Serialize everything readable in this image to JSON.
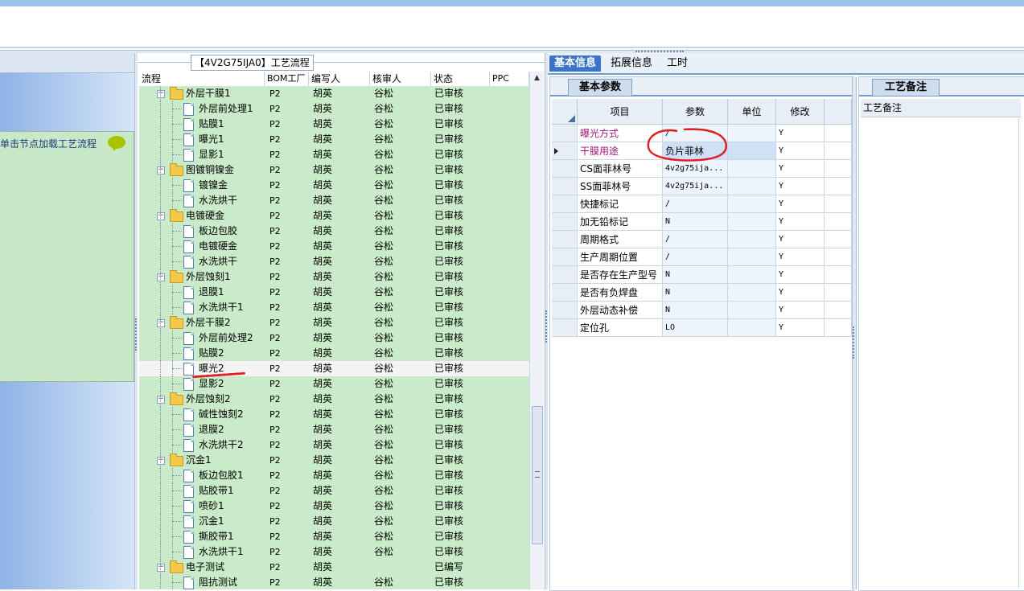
{
  "process_panel": {
    "title": "【4V2G75IJA0】工艺流程",
    "columns": [
      "流程",
      "BOM工厂",
      "编写人",
      "核审人",
      "状态",
      "PPC"
    ]
  },
  "left_panel": {
    "hint": "单击节点加载工艺流程"
  },
  "tree_rows": [
    {
      "level": 0,
      "name": "外层干膜1",
      "bom": "P2",
      "writer": "胡英",
      "reviewer": "谷松",
      "status": "已审核"
    },
    {
      "level": 1,
      "name": "外层前处理1",
      "bom": "P2",
      "writer": "胡英",
      "reviewer": "谷松",
      "status": "已审核"
    },
    {
      "level": 1,
      "name": "贴膜1",
      "bom": "P2",
      "writer": "胡英",
      "reviewer": "谷松",
      "status": "已审核"
    },
    {
      "level": 1,
      "name": "曝光1",
      "bom": "P2",
      "writer": "胡英",
      "reviewer": "谷松",
      "status": "已审核"
    },
    {
      "level": 1,
      "name": "显影1",
      "bom": "P2",
      "writer": "胡英",
      "reviewer": "谷松",
      "status": "已审核"
    },
    {
      "level": 0,
      "name": "图镀铜镍金",
      "bom": "P2",
      "writer": "胡英",
      "reviewer": "谷松",
      "status": "已审核"
    },
    {
      "level": 1,
      "name": "镀镍金",
      "bom": "P2",
      "writer": "胡英",
      "reviewer": "谷松",
      "status": "已审核"
    },
    {
      "level": 1,
      "name": "水洗烘干",
      "bom": "P2",
      "writer": "胡英",
      "reviewer": "谷松",
      "status": "已审核"
    },
    {
      "level": 0,
      "name": "电镀硬金",
      "bom": "P2",
      "writer": "胡英",
      "reviewer": "谷松",
      "status": "已审核"
    },
    {
      "level": 1,
      "name": "板边包胶",
      "bom": "P2",
      "writer": "胡英",
      "reviewer": "谷松",
      "status": "已审核"
    },
    {
      "level": 1,
      "name": "电镀硬金",
      "bom": "P2",
      "writer": "胡英",
      "reviewer": "谷松",
      "status": "已审核"
    },
    {
      "level": 1,
      "name": "水洗烘干",
      "bom": "P2",
      "writer": "胡英",
      "reviewer": "谷松",
      "status": "已审核"
    },
    {
      "level": 0,
      "name": "外层蚀刻1",
      "bom": "P2",
      "writer": "胡英",
      "reviewer": "谷松",
      "status": "已审核"
    },
    {
      "level": 1,
      "name": "退膜1",
      "bom": "P2",
      "writer": "胡英",
      "reviewer": "谷松",
      "status": "已审核"
    },
    {
      "level": 1,
      "name": "水洗烘干1",
      "bom": "P2",
      "writer": "胡英",
      "reviewer": "谷松",
      "status": "已审核"
    },
    {
      "level": 0,
      "name": "外层干膜2",
      "bom": "P2",
      "writer": "胡英",
      "reviewer": "谷松",
      "status": "已审核"
    },
    {
      "level": 1,
      "name": "外层前处理2",
      "bom": "P2",
      "writer": "胡英",
      "reviewer": "谷松",
      "status": "已审核"
    },
    {
      "level": 1,
      "name": "贴膜2",
      "bom": "P2",
      "writer": "胡英",
      "reviewer": "谷松",
      "status": "已审核"
    },
    {
      "level": 1,
      "name": "曝光2",
      "bom": "P2",
      "writer": "胡英",
      "reviewer": "谷松",
      "status": "已审核",
      "selected": true
    },
    {
      "level": 1,
      "name": "显影2",
      "bom": "P2",
      "writer": "胡英",
      "reviewer": "谷松",
      "status": "已审核"
    },
    {
      "level": 0,
      "name": "外层蚀刻2",
      "bom": "P2",
      "writer": "胡英",
      "reviewer": "谷松",
      "status": "已审核"
    },
    {
      "level": 1,
      "name": "碱性蚀刻2",
      "bom": "P2",
      "writer": "胡英",
      "reviewer": "谷松",
      "status": "已审核"
    },
    {
      "level": 1,
      "name": "退膜2",
      "bom": "P2",
      "writer": "胡英",
      "reviewer": "谷松",
      "status": "已审核"
    },
    {
      "level": 1,
      "name": "水洗烘干2",
      "bom": "P2",
      "writer": "胡英",
      "reviewer": "谷松",
      "status": "已审核"
    },
    {
      "level": 0,
      "name": "沉金1",
      "bom": "P2",
      "writer": "胡英",
      "reviewer": "谷松",
      "status": "已审核"
    },
    {
      "level": 1,
      "name": "板边包胶1",
      "bom": "P2",
      "writer": "胡英",
      "reviewer": "谷松",
      "status": "已审核"
    },
    {
      "level": 1,
      "name": "贴胶带1",
      "bom": "P2",
      "writer": "胡英",
      "reviewer": "谷松",
      "status": "已审核"
    },
    {
      "level": 1,
      "name": "喷砂1",
      "bom": "P2",
      "writer": "胡英",
      "reviewer": "谷松",
      "status": "已审核"
    },
    {
      "level": 1,
      "name": "沉金1",
      "bom": "P2",
      "writer": "胡英",
      "reviewer": "谷松",
      "status": "已审核"
    },
    {
      "level": 1,
      "name": "撕胶带1",
      "bom": "P2",
      "writer": "胡英",
      "reviewer": "谷松",
      "status": "已审核"
    },
    {
      "level": 1,
      "name": "水洗烘干1",
      "bom": "P2",
      "writer": "胡英",
      "reviewer": "谷松",
      "status": "已审核"
    },
    {
      "level": 0,
      "name": "电子测试",
      "bom": "P2",
      "writer": "胡英",
      "reviewer": "",
      "status": "已编写"
    },
    {
      "level": 1,
      "name": "阻抗测试",
      "bom": "P2",
      "writer": "胡英",
      "reviewer": "谷松",
      "status": "已审核"
    }
  ],
  "tabs": [
    "基本信息",
    "拓展信息",
    "工时"
  ],
  "basic_params": {
    "panel_tab": "基本参数",
    "columns": [
      "项目",
      "参数",
      "单位",
      "修改"
    ],
    "rows": [
      {
        "item": "曝光方式",
        "value": "/",
        "unit": "",
        "edit": "Y",
        "highlight": true
      },
      {
        "item": "干膜用途",
        "value": "负片菲林",
        "unit": "",
        "edit": "Y",
        "highlight": true,
        "current": true
      },
      {
        "item": "CS面菲林号",
        "value": "4v2g75ija...",
        "unit": "",
        "edit": "Y"
      },
      {
        "item": "SS面菲林号",
        "value": "4v2g75ija...",
        "unit": "",
        "edit": "Y"
      },
      {
        "item": "快捷标记",
        "value": "/",
        "unit": "",
        "edit": "Y"
      },
      {
        "item": "加无铅标记",
        "value": "N",
        "unit": "",
        "edit": "Y"
      },
      {
        "item": "周期格式",
        "value": "/",
        "unit": "",
        "edit": "Y"
      },
      {
        "item": "生产周期位置",
        "value": "/",
        "unit": "",
        "edit": "Y"
      },
      {
        "item": "是否存在生产型号",
        "value": "N",
        "unit": "",
        "edit": "Y"
      },
      {
        "item": "是否有负焊盘",
        "value": "N",
        "unit": "",
        "edit": "Y"
      },
      {
        "item": "外层动态补偿",
        "value": "N",
        "unit": "",
        "edit": "Y"
      },
      {
        "item": "定位孔",
        "value": "LO",
        "unit": "",
        "edit": "Y"
      }
    ]
  },
  "remarks": {
    "panel_tab": "工艺备注",
    "column": "工艺备注"
  },
  "colors": {
    "accent": "#3a73c8",
    "tree_bg": "#c9ebc9",
    "highlight_text": "#a0187a",
    "annotation": "#e02020"
  }
}
